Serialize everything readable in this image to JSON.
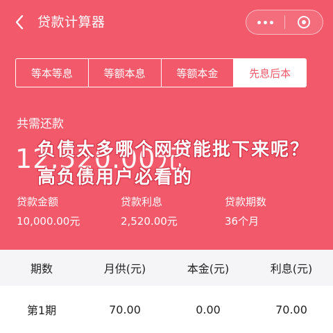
{
  "header": {
    "title": "贷款计算器",
    "back_icon": "chevron-left-icon",
    "more_icon": "more-dots-icon",
    "close_icon": "target-icon"
  },
  "tabs": [
    {
      "label": "等本等息",
      "active": false
    },
    {
      "label": "等额本息",
      "active": false
    },
    {
      "label": "等额本金",
      "active": false
    },
    {
      "label": "先息后本",
      "active": true
    }
  ],
  "summary": {
    "total_label": "共需还款",
    "total_amount": "12,520.00元",
    "overlay_text": "负债太多哪个网贷能批下来呢？高负债用户必看的",
    "loan_amount_label": "贷款金额",
    "loan_amount_value": "10,000.00元",
    "interest_label": "贷款利息",
    "interest_value": "2,520.00元",
    "term_label": "贷款期数",
    "term_value": "36个月"
  },
  "table": {
    "headers": [
      "期数",
      "月供(元)",
      "本金(元)",
      "利息(元)"
    ],
    "rows": [
      [
        "第1期",
        "70.00",
        "0.00",
        "70.00"
      ]
    ]
  },
  "colors": {
    "accent": "#f2596a",
    "text_light": "#ffffff",
    "table_header_bg": "#f5f5f7"
  }
}
